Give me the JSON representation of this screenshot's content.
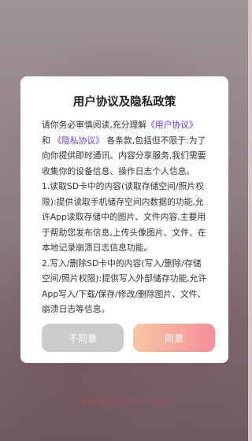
{
  "dialog": {
    "title": "用户协议及隐私政策",
    "intro_prefix": "请你务必审慎阅读,充分理解",
    "link_user_agreement": "《用户协议》",
    "and_word": "和",
    "link_privacy_policy": "《隐私协议》",
    "intro_suffix": "各条款,包括但不限于:为了向你提供即时通讯、内容分享服务,我们需要收集你的设备信息、操作日志个人信息。",
    "item_1": "1.读取SD卡中的内容(读取存储空间/照片权限):提供读取手机储存空间内数据的功能,允许App读取存储中的图片、文件内容,主要用于帮助您发布信息,上传头像图片、文件、在本地记录崩溃日志信息功能。",
    "item_2": "2.写入/删除SD卡中的内容(写入/删除/存储空间/照片权限):提供写入外部储存功能,允许App写入/下载/保存/修改/删除图片、文件、崩溃日志等信息。",
    "disagree_label": "不同意",
    "agree_label": "同意"
  },
  "footer": {
    "age_notice": "本APP限18岁以上用户使用"
  },
  "colors": {
    "link": "#6c3ad6",
    "agree_gradient_start": "#f6c7a3",
    "agree_gradient_end": "#f58e9c",
    "disagree_bg": "#cbcbcb"
  }
}
